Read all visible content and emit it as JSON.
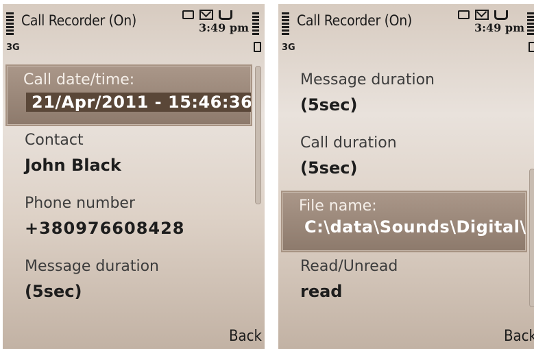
{
  "screens": [
    {
      "status": {
        "title": "Call Recorder (On)",
        "network": "3G",
        "time": "3:49 pm"
      },
      "items": [
        {
          "label": "Call date/time:",
          "value": "21/Apr/2011 - 15:46:36",
          "selected": true
        },
        {
          "label": "Contact",
          "value": "John Black"
        },
        {
          "label": "Phone number",
          "value": "+380976608428"
        },
        {
          "label": "Message duration",
          "value": "(5sec)"
        }
      ],
      "softkey": "Back"
    },
    {
      "status": {
        "title": "Call Recorder (On)",
        "network": "3G",
        "time": "3:49 pm"
      },
      "items": [
        {
          "label": "Message duration",
          "value": "(5sec)"
        },
        {
          "label": "Call duration",
          "value": "(5sec)"
        },
        {
          "label": "File name:",
          "value": "C:\\data\\Sounds\\Digital\\CR",
          "selected": true
        },
        {
          "label": "Read/Unread",
          "value": "read"
        }
      ],
      "softkey": "Back"
    }
  ],
  "colors": {
    "selection": "#8d7a6c",
    "value_box": "#5a4738",
    "background": "#e9e2dc"
  },
  "icons": [
    "signal-strength-icon",
    "sim-icon",
    "envelope-icon",
    "call-icon",
    "battery-icon"
  ]
}
